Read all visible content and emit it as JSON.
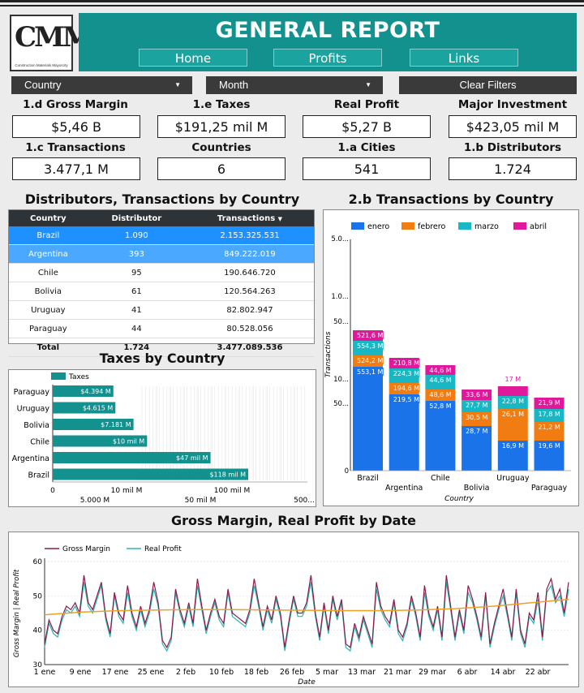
{
  "header": {
    "logo_text": "CMM",
    "logo_subtitle": "Construction Materials Mayorcity",
    "title": "GENERAL REPORT",
    "nav": [
      "Home",
      "Profits",
      "Links"
    ]
  },
  "filters": {
    "country": "Country",
    "month": "Month",
    "clear": "Clear Filters"
  },
  "kpis": [
    {
      "label": "1.d Gross Margin",
      "value": "$5,46 B"
    },
    {
      "label": "1.e Taxes",
      "value": "$191,25 mil M"
    },
    {
      "label": "Real Profit",
      "value": "$5,27 B"
    },
    {
      "label": "Major Investment",
      "value": "$423,05 mil M"
    },
    {
      "label": "1.c Transactions",
      "value": "3.477,1 M"
    },
    {
      "label": "Countries",
      "value": "6"
    },
    {
      "label": "1.a Cities",
      "value": "541"
    },
    {
      "label": "1.b Distributors",
      "value": "1.724"
    }
  ],
  "dist_table": {
    "title": "Distributors, Transactions by Country",
    "headers": [
      "Country",
      "Distributor",
      "Transactions"
    ],
    "rows": [
      [
        "Brazil",
        "1.090",
        "2.153.325.531"
      ],
      [
        "Argentina",
        "393",
        "849.222.019"
      ],
      [
        "Chile",
        "95",
        "190.646.720"
      ],
      [
        "Bolivia",
        "61",
        "120.564.263"
      ],
      [
        "Uruguay",
        "41",
        "82.802.947"
      ],
      [
        "Paraguay",
        "44",
        "80.528.056"
      ]
    ],
    "total": [
      "Total",
      "1.724",
      "3.477.089.536"
    ]
  },
  "chart_data": [
    {
      "type": "bar",
      "title": "Taxes by Country",
      "orientation": "horizontal",
      "categories": [
        "Paraguay",
        "Uruguay",
        "Bolivia",
        "Chile",
        "Argentina",
        "Brazil"
      ],
      "series": [
        {
          "name": "Taxes",
          "values": [
            4394,
            4615,
            7181,
            10000,
            47000,
            118000
          ],
          "labels": [
            "$4.394 M",
            "$4.615 M",
            "$7.181 M",
            "$10 mil M",
            "$47 mil M",
            "$118 mil M"
          ]
        }
      ],
      "x_ticks_row1": [
        "0",
        "10 mil M",
        "100 mil M"
      ],
      "x_ticks_row2": [
        "5.000 M",
        "50 mil M",
        "500..."
      ],
      "scale": "log",
      "color": "#13918f"
    },
    {
      "type": "bar",
      "stacked": true,
      "title": "2.b Transactions by Country",
      "categories": [
        "Brazil",
        "Argentina",
        "Chile",
        "Bolivia",
        "Uruguay",
        "Paraguay"
      ],
      "series": [
        {
          "name": "enero",
          "color": "#1a73e8",
          "labels": [
            "553,1 M",
            "219,5 M",
            "52,8 M",
            "28,7 M",
            "16,9 M",
            "19,6 M"
          ]
        },
        {
          "name": "febrero",
          "color": "#f07c12",
          "labels": [
            "524,2 M",
            "194,6 M",
            "48,6 M",
            "30,5 M",
            "26,1 M",
            "21,2 M"
          ]
        },
        {
          "name": "marzo",
          "color": "#19b6c4",
          "labels": [
            "554,3 M",
            "224,3 M",
            "44,6 M",
            "27,7 M",
            "22,8 M",
            "17,8 M"
          ]
        },
        {
          "name": "abril",
          "color": "#e0189a",
          "labels": [
            "521,6 M",
            "210,8 M",
            "44,6 M",
            "33,6 M",
            "17 M",
            "21,9 M"
          ]
        }
      ],
      "y_ticks": [
        "5.0...",
        "1.0...",
        "50...",
        "10...",
        "50...",
        "0"
      ],
      "ylabel": "Transactions",
      "xlabel": "Country"
    },
    {
      "type": "line",
      "title": "Gross Margin, Real Profit by Date",
      "xlabel": "Date",
      "ylabel": "Gross Margin | Real Profit",
      "ylim": [
        30,
        60
      ],
      "y_ticks": [
        "60",
        "50",
        "40",
        "30"
      ],
      "x_ticks": [
        "1 ene",
        "9 ene",
        "17 ene",
        "25 ene",
        "2 feb",
        "10 feb",
        "18 feb",
        "26 feb",
        "5 mar",
        "13 mar",
        "21 mar",
        "29 mar",
        "6 abr",
        "14 abr",
        "22 abr"
      ],
      "series": [
        {
          "name": "Gross Margin",
          "color": "#8b1a4a",
          "values": [
            36,
            43,
            40,
            39,
            44,
            47,
            46,
            48,
            45,
            56,
            48,
            46,
            50,
            54,
            44,
            39,
            51,
            45,
            43,
            53,
            45,
            41,
            47,
            42,
            46,
            54,
            48,
            37,
            35,
            38,
            52,
            46,
            42,
            48,
            42,
            55,
            47,
            40,
            45,
            49,
            44,
            42,
            52,
            45,
            44,
            43,
            42,
            46,
            55,
            48,
            41,
            47,
            43,
            50,
            45,
            35,
            43,
            50,
            45,
            45,
            48,
            56,
            45,
            38,
            48,
            40,
            50,
            44,
            49,
            36,
            35,
            42,
            38,
            44,
            40,
            36,
            54,
            47,
            44,
            42,
            49,
            40,
            38,
            42,
            50,
            45,
            38,
            53,
            45,
            41,
            47,
            38,
            56,
            47,
            38,
            46,
            40,
            53,
            49,
            44,
            38,
            51,
            36,
            42,
            47,
            52,
            45,
            38,
            52,
            40,
            36,
            45,
            43,
            51,
            38,
            52,
            55,
            49,
            52,
            45,
            54
          ]
        },
        {
          "name": "Real Profit",
          "color": "#2bb5b8",
          "values": [
            35,
            42,
            39,
            38,
            43,
            46,
            45,
            47,
            44,
            54,
            47,
            45,
            49,
            53,
            43,
            38,
            50,
            44,
            42,
            51,
            44,
            40,
            46,
            41,
            45,
            52,
            47,
            36,
            34,
            37,
            51,
            45,
            41,
            47,
            41,
            53,
            46,
            39,
            44,
            48,
            43,
            41,
            51,
            44,
            43,
            42,
            41,
            45,
            53,
            47,
            40,
            46,
            42,
            49,
            44,
            34,
            42,
            49,
            44,
            44,
            47,
            54,
            44,
            37,
            47,
            39,
            49,
            43,
            48,
            35,
            34,
            41,
            37,
            43,
            39,
            35,
            52,
            46,
            43,
            41,
            48,
            39,
            37,
            41,
            49,
            44,
            37,
            51,
            44,
            40,
            46,
            37,
            54,
            46,
            37,
            45,
            39,
            51,
            48,
            43,
            37,
            50,
            35,
            41,
            46,
            50,
            44,
            37,
            51,
            39,
            35,
            44,
            42,
            49,
            37,
            51,
            53,
            48,
            50,
            44,
            52
          ]
        },
        {
          "name": "trend",
          "color": "#f0a020",
          "values": [
            44.5,
            45.3,
            45.7,
            45.9,
            46.0,
            46.0,
            45.9,
            45.8,
            45.7,
            45.7,
            45.9,
            46.3,
            47.0,
            48.0,
            49.0
          ]
        }
      ]
    }
  ]
}
